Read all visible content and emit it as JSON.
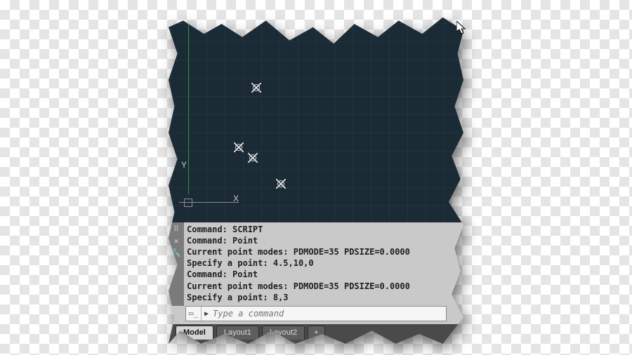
{
  "axis": {
    "x_label": "X",
    "y_label": "Y"
  },
  "cmd_history": [
    "Command: SCRIPT",
    "Command: Point",
    "Current point modes:  PDMODE=35  PDSIZE=0.0000",
    "Specify a point: 4.5,10,0",
    "Command: Point",
    "Current point modes:  PDMODE=35  PDSIZE=0.0000",
    "Specify a point: 8,3"
  ],
  "cmd_input": {
    "placeholder": "Type a command"
  },
  "gutter": {
    "handle": "⠿",
    "close": "✕",
    "wrench": "🔧"
  },
  "cmd_icon": "▭_",
  "tabs": {
    "model": "Model",
    "layout1": "Layout1",
    "layout2": "Layout2",
    "new": "+"
  }
}
